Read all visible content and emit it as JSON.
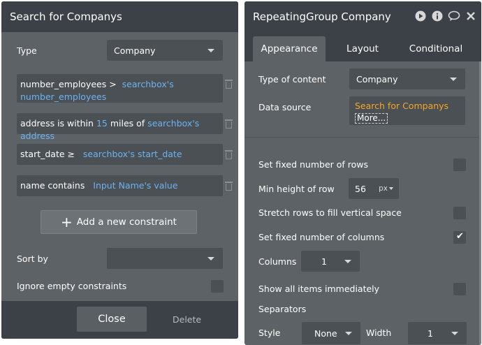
{
  "left_panel": {
    "title": "Search for Companys",
    "type_label": "Type",
    "type_value": "Company",
    "constraints": [
      {
        "field": "number_employees >",
        "op_value": "",
        "value": "searchbox's",
        "value2": "number_employees"
      },
      {
        "field": "address is within",
        "num": "15",
        "mid": "miles of",
        "value": "searchbox's address"
      },
      {
        "field": "start_date ≥",
        "value": "searchbox's start_date"
      },
      {
        "field": "name contains",
        "value": "Input Name's value"
      }
    ],
    "add_constraint_label": "Add a new constraint",
    "sort_by_label": "Sort by",
    "sort_by_value": "",
    "ignore_empty_label": "Ignore empty constraints",
    "close_label": "Close",
    "delete_label": "Delete"
  },
  "right_panel": {
    "title": "RepeatingGroup Company",
    "tabs": [
      "Appearance",
      "Layout",
      "Conditional"
    ],
    "active_tab": "Appearance",
    "type_of_content_label": "Type of content",
    "type_of_content_value": "Company",
    "data_source_label": "Data source",
    "data_source_value": "Search for Companys",
    "data_source_more": "More...",
    "fixed_rows_label": "Set fixed number of rows",
    "fixed_rows_checked": false,
    "min_height_label": "Min height of row",
    "min_height_value": "56",
    "min_height_unit": "px",
    "stretch_rows_label": "Stretch rows to fill vertical space",
    "stretch_rows_checked": false,
    "fixed_columns_label": "Set fixed number of columns",
    "fixed_columns_checked": true,
    "columns_label": "Columns",
    "columns_value": "1",
    "show_all_label": "Show all items immediately",
    "show_all_checked": false,
    "separators_label": "Separators",
    "style_label": "Style",
    "style_value": "None",
    "width_label": "Width",
    "width_value": "1"
  },
  "colors": {
    "panel_bg": "#5d6266",
    "header_bg": "#3b4147",
    "field_bg": "#4b5055",
    "dynamic_blue": "#6bb3f0",
    "dynamic_orange": "#f5a623"
  },
  "icons": [
    "trash-icon",
    "plus-icon",
    "play-icon",
    "info-icon",
    "comment-icon",
    "close-icon",
    "checkmark-icon",
    "chevron-down-icon"
  ]
}
